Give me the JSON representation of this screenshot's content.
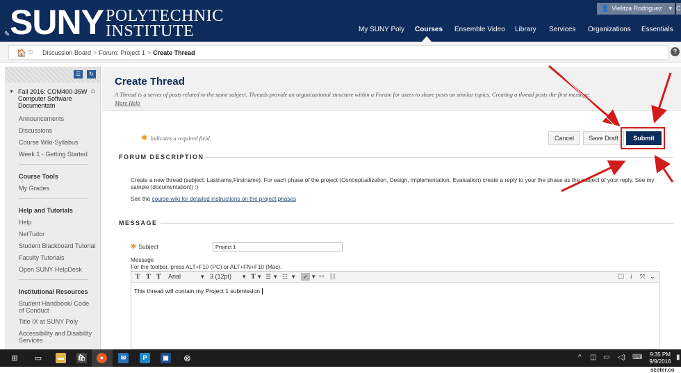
{
  "branding": {
    "logo_main": "SUNY",
    "logo_line1": "POLYTECHNIC",
    "logo_line2": "INSTITUTE"
  },
  "user": {
    "name": "Vielitza Rodriguez",
    "icon": "user-icon",
    "extra": "C"
  },
  "top_nav": [
    {
      "label": "My SUNY Poly"
    },
    {
      "label": "Courses",
      "active": true
    },
    {
      "label": "Ensemble Video"
    },
    {
      "label": "Library"
    },
    {
      "label": "Services"
    },
    {
      "label": "Organizations"
    },
    {
      "label": "Essentials"
    }
  ],
  "breadcrumb": {
    "items": [
      "Discussion Board",
      "Forum: Project 1"
    ],
    "current": "Create Thread",
    "separator": ">"
  },
  "sidebar": {
    "course_title": "Fall 2016: COM400-35W Computer Software Documentatn",
    "links_group1": [
      "Announcements",
      "Discussions",
      "Course Wiki-Syllabus",
      "Week 1 - Getting Started"
    ],
    "course_tools_heading": "Course Tools",
    "links_group2": [
      "My Grades"
    ],
    "help_heading": "Help and Tutorials",
    "links_group3": [
      "Help",
      "NetTudor",
      "Student Blackboard Tutorial",
      "Faculty Tutorials",
      "Open SUNY HelpDesk"
    ],
    "institutional_heading": "Institutional Resources",
    "links_group4": [
      "Student Handbook/ Code of Conduct",
      "Title IX at SUNY Poly",
      "Accessibility and Disability Services"
    ]
  },
  "page": {
    "title": "Create Thread",
    "description": "A Thread is a series of posts related to the same subject. Threads provide an organizational structure within a Forum for users to share posts on similar topics. Creating a thread posts the first message.",
    "more_help": "More Help",
    "required_note": "Indicates a required field.",
    "cancel_label": "Cancel",
    "save_draft_label": "Save Draft",
    "submit_label": "Submit"
  },
  "forum_description": {
    "heading": "FORUM DESCRIPTION",
    "text": "Create a new thread (subject: Lastname,Firstname). For each phase of the project (Conceptualization, Design, Implementation, Evaluation) create a reply to your the phase as the subject of your reply. See my sample (documentation!) :)",
    "see_prefix": "See the",
    "see_link": "course wiki for detailed instructions on the project phases"
  },
  "message": {
    "heading": "MESSAGE",
    "subject_label": "Subject",
    "subject_value": "Project 1",
    "message_label": "Message",
    "toolbar_hint": "For the toolbar, press ALT+F10 (PC) or ALT+FN+F10 (Mac).",
    "font_family": "Arial",
    "font_size": "3 (12pt)",
    "body_text": "This thread will contain my Project 1 submission."
  },
  "taskbar": {
    "time": "9:35 PM",
    "date": "9/9/2016"
  },
  "watermark": "szoter.co",
  "colors": {
    "brand_navy": "#0d2b5b",
    "annotation_red": "#d21c1c",
    "required_orange": "#e8962a"
  }
}
